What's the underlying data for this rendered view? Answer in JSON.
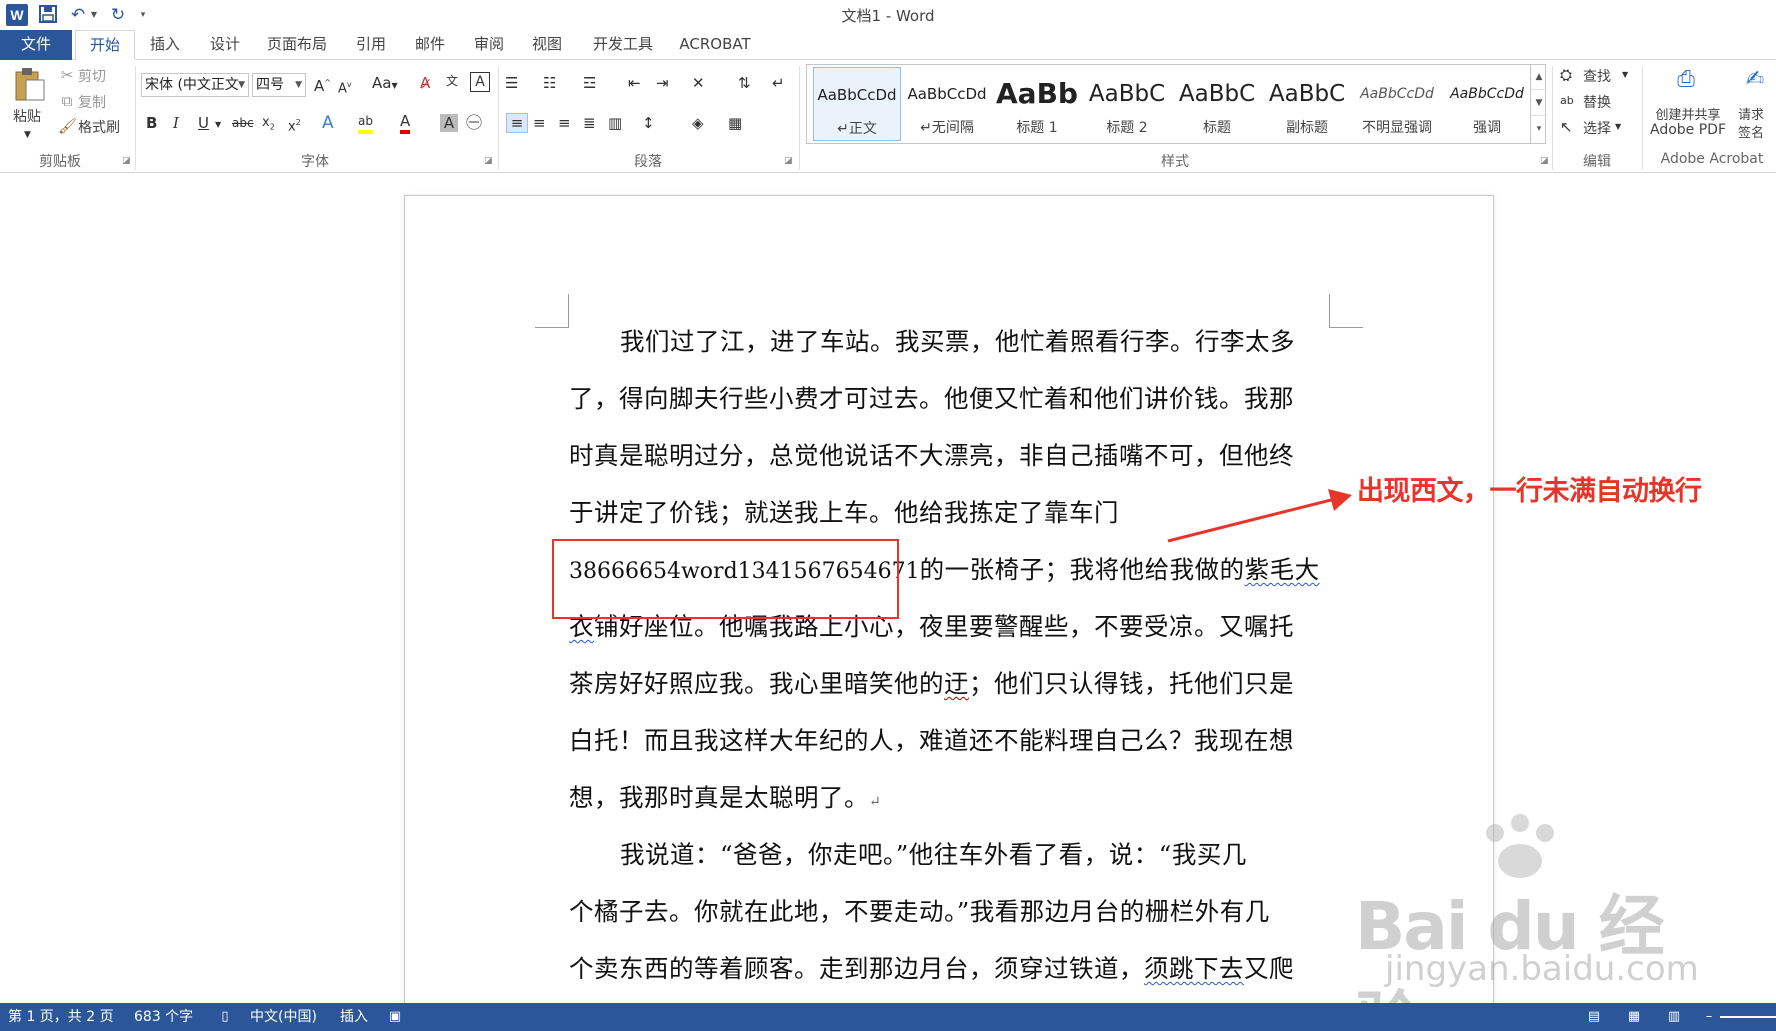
{
  "window": {
    "title": "文档1 - Word"
  },
  "tabs": [
    "文件",
    "开始",
    "插入",
    "设计",
    "页面布局",
    "引用",
    "邮件",
    "审阅",
    "视图",
    "开发工具",
    "ACROBAT"
  ],
  "ribbon": {
    "clipboard": {
      "paste": "粘贴",
      "cut": "剪切",
      "copy": "复制",
      "format_painter": "格式刷",
      "label": "剪贴板"
    },
    "font": {
      "font_name": "宋体 (中文正文",
      "font_size": "四号",
      "label": "字体"
    },
    "paragraph": {
      "label": "段落"
    },
    "styles": {
      "label": "样式",
      "items": [
        {
          "sample": "AaBbCcDd",
          "name": "正文"
        },
        {
          "sample": "AaBbCcDd",
          "name": "无间隔"
        },
        {
          "sample": "AaBb",
          "name": "标题 1"
        },
        {
          "sample": "AaBbC",
          "name": "标题 2"
        },
        {
          "sample": "AaBbC",
          "name": "标题"
        },
        {
          "sample": "AaBbC",
          "name": "副标题"
        },
        {
          "sample": "AaBbCcDd",
          "name": "不明显强调"
        },
        {
          "sample": "AaBbCcDd",
          "name": "强调"
        }
      ]
    },
    "editing": {
      "find": "查找",
      "replace": "替换",
      "select": "选择",
      "label": "编辑"
    },
    "acrobat": {
      "create_pdf_line1": "创建并共享",
      "create_pdf_line2": "Adobe PDF",
      "sign_line1": "请求",
      "sign_line2": "签名",
      "label": "Adobe Acrobat"
    }
  },
  "document": {
    "lines": [
      "我们过了江，进了车站。我买票，他忙着照看行李。行李太多",
      "了，得向脚夫行些小费才可过去。他便又忙着和他们讲价钱。我那",
      "时真是聪明过分，总觉他说话不大漂亮，非自己插嘴不可，但他终",
      "于讲定了价钱；就送我上车。他给我拣定了靠车门",
      "38666654word1341567654671",
      "的一张椅子；我将他给我做的",
      "紫毛大",
      "衣",
      "铺好座位。他嘱我路上小心，夜里要警醒些，不要受凉。又嘱托",
      "茶房好好照应我。我心里暗笑他的",
      "迂",
      "；他们只认得钱，托他们只是",
      "白托！而且我这样大年纪的人，难道还不能料理自己么？我现在想",
      "想，我那时真是太聪明了。",
      "我说道：“爸爸，你走吧。”他往车外看了看，说：“我买几",
      "个橘子去。你就在此地，不要走动。”我看那边月台的栅栏外有几",
      "个卖东西的等着顾客。走到那边月台，须穿过铁道，",
      "须跳下去",
      "又爬"
    ]
  },
  "annotation": {
    "text": "出现西文，一行未满自动换行",
    "color": "#e8352c"
  },
  "watermark": {
    "brand": "Bai du 经验",
    "url": "jingyan.baidu.com"
  },
  "statusbar": {
    "page": "第 1 页，共 2 页",
    "words": "683 个字",
    "language": "中文(中国)",
    "mode": "插入"
  },
  "colors": {
    "accent": "#2b579a",
    "annotation": "#e8352c"
  }
}
